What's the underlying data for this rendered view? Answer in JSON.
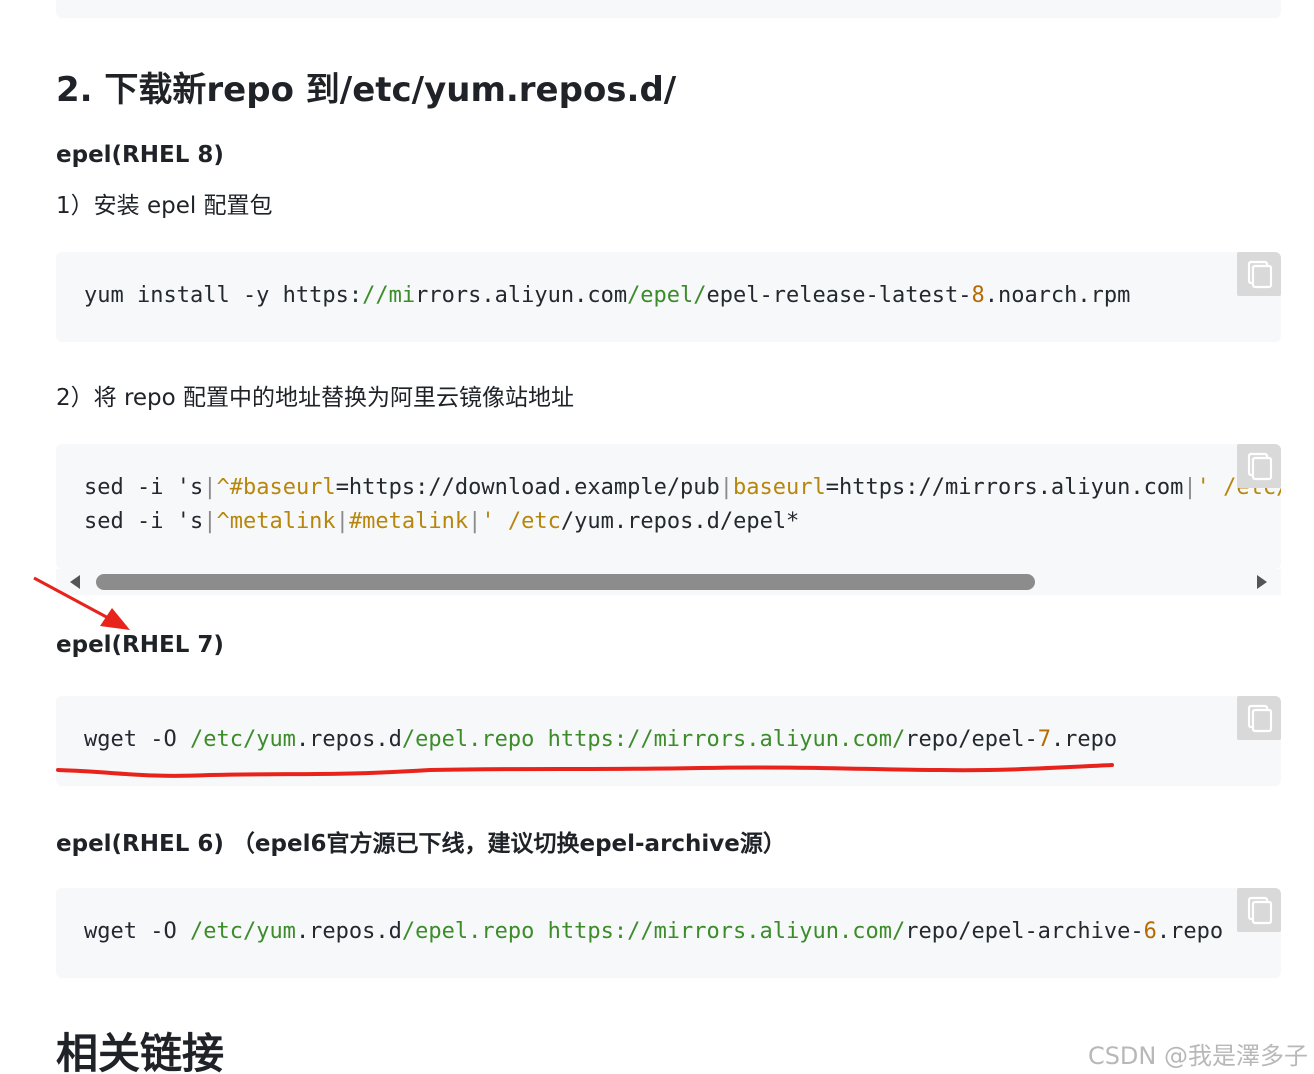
{
  "section_heading": "2. 下载新repo 到/etc/yum.repos.d/",
  "rhel8": {
    "label": "epel(RHEL 8)",
    "step1": "1）安装 epel 配置包",
    "cmd1": {
      "a": "yum install -y https:",
      "b": "//mi",
      "c": "rrors.aliyun.com",
      "d": "/epel/",
      "e": "epel-release-latest-",
      "f": "8",
      "g": ".noarch.rpm"
    },
    "step2": "2）将 repo 配置中的地址替换为阿里云镜像站地址",
    "cmd2_line1": {
      "a": "sed -i 's",
      "b": "|",
      "c": "^#baseurl",
      "d": "=https://download.example/pub",
      "e": "|",
      "f": "baseurl",
      "g": "=https://mirrors.aliyun.com",
      "h": "|",
      "i": "' /etc/yum.repos.d/epel*"
    },
    "cmd2_line2": {
      "a": "sed -i 's",
      "b": "|",
      "c": "^metalink",
      "d": "|",
      "e": "#metalink",
      "f": "|",
      "g": "' /etc",
      "h": "/yum.repos.d/epel*"
    }
  },
  "rhel7": {
    "label": "epel(RHEL 7)",
    "cmd": {
      "a": "wget -O ",
      "b": "/etc/yum",
      "c": ".repos.d",
      "d": "/epel.repo https://mirrors.aliyun.com/",
      "e": "repo/epel-",
      "f": "7",
      "g": ".repo"
    }
  },
  "rhel6": {
    "label": "epel(RHEL 6) （epel6官方源已下线，建议切换epel-archive源）",
    "cmd": {
      "a": "wget -O ",
      "b": "/etc/yum",
      "c": ".repos.d",
      "d": "/epel.repo https://mirrors.aliyun.com/",
      "e": "repo/epel-archive-",
      "f": "6",
      "g": ".repo"
    }
  },
  "related_heading": "相关链接",
  "watermark": "CSDN @我是澤多子",
  "icons": {
    "copy": "copy-icon",
    "scroll_left": "triangle-left-icon",
    "scroll_right": "triangle-right-icon"
  },
  "colors": {
    "code_bg": "#f6f8fa",
    "path_green": "#3c8c2a",
    "regex_gold": "#b8860b",
    "annotation_red": "#e8231c"
  },
  "scrollbar": {
    "thumb_fraction": 0.82,
    "scroll_position": 0.0
  }
}
